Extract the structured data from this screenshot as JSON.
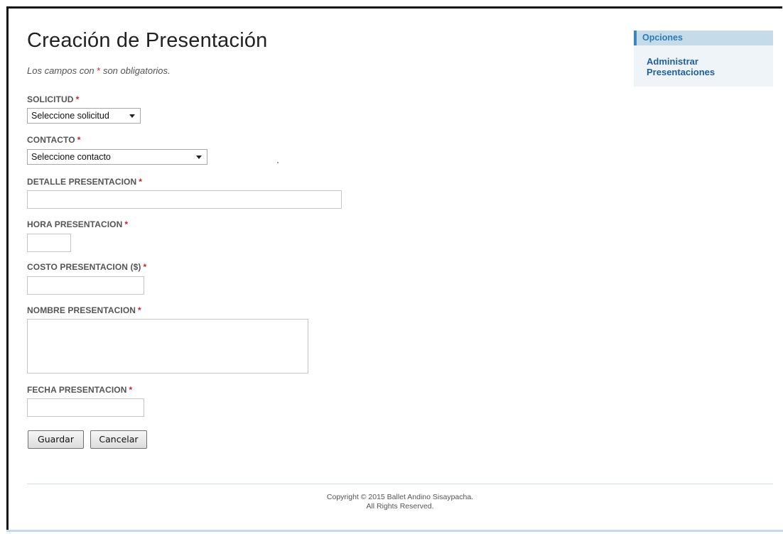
{
  "page": {
    "title": "Creación de Presentación",
    "required_note_prefix": "Los campos con ",
    "required_note_star": "*",
    "required_note_suffix": " son obligatorios."
  },
  "form": {
    "required_star": "*",
    "solicitud": {
      "label": "SOLICITUD",
      "selected": "Seleccione solicitud"
    },
    "contacto": {
      "label": "CONTACTO",
      "selected": "Seleccione contacto"
    },
    "detalle": {
      "label": "DETALLE PRESENTACION",
      "value": ""
    },
    "hora": {
      "label": "HORA PRESENTACION",
      "value": ""
    },
    "costo": {
      "label": "COSTO PRESENTACION ($)",
      "value": ""
    },
    "nombre": {
      "label": "NOMBRE PRESENTACION",
      "value": ""
    },
    "fecha": {
      "label": "FECHA PRESENTACION",
      "value": ""
    },
    "save_label": "Guardar",
    "cancel_label": "Cancelar"
  },
  "sidebar": {
    "header": "Opciones",
    "items": [
      {
        "label_line1": "Administrar",
        "label_line2": "Presentaciones"
      }
    ]
  },
  "footer": {
    "line1": "Copyright © 2015 Ballet Andino Sisaypacha.",
    "line2": "All Rights Reserved."
  },
  "colors": {
    "accent": "#2b7bb9",
    "link": "#1f5f9c",
    "required": "#cc2222",
    "sidebar_header_bg": "#c5dbe9"
  }
}
